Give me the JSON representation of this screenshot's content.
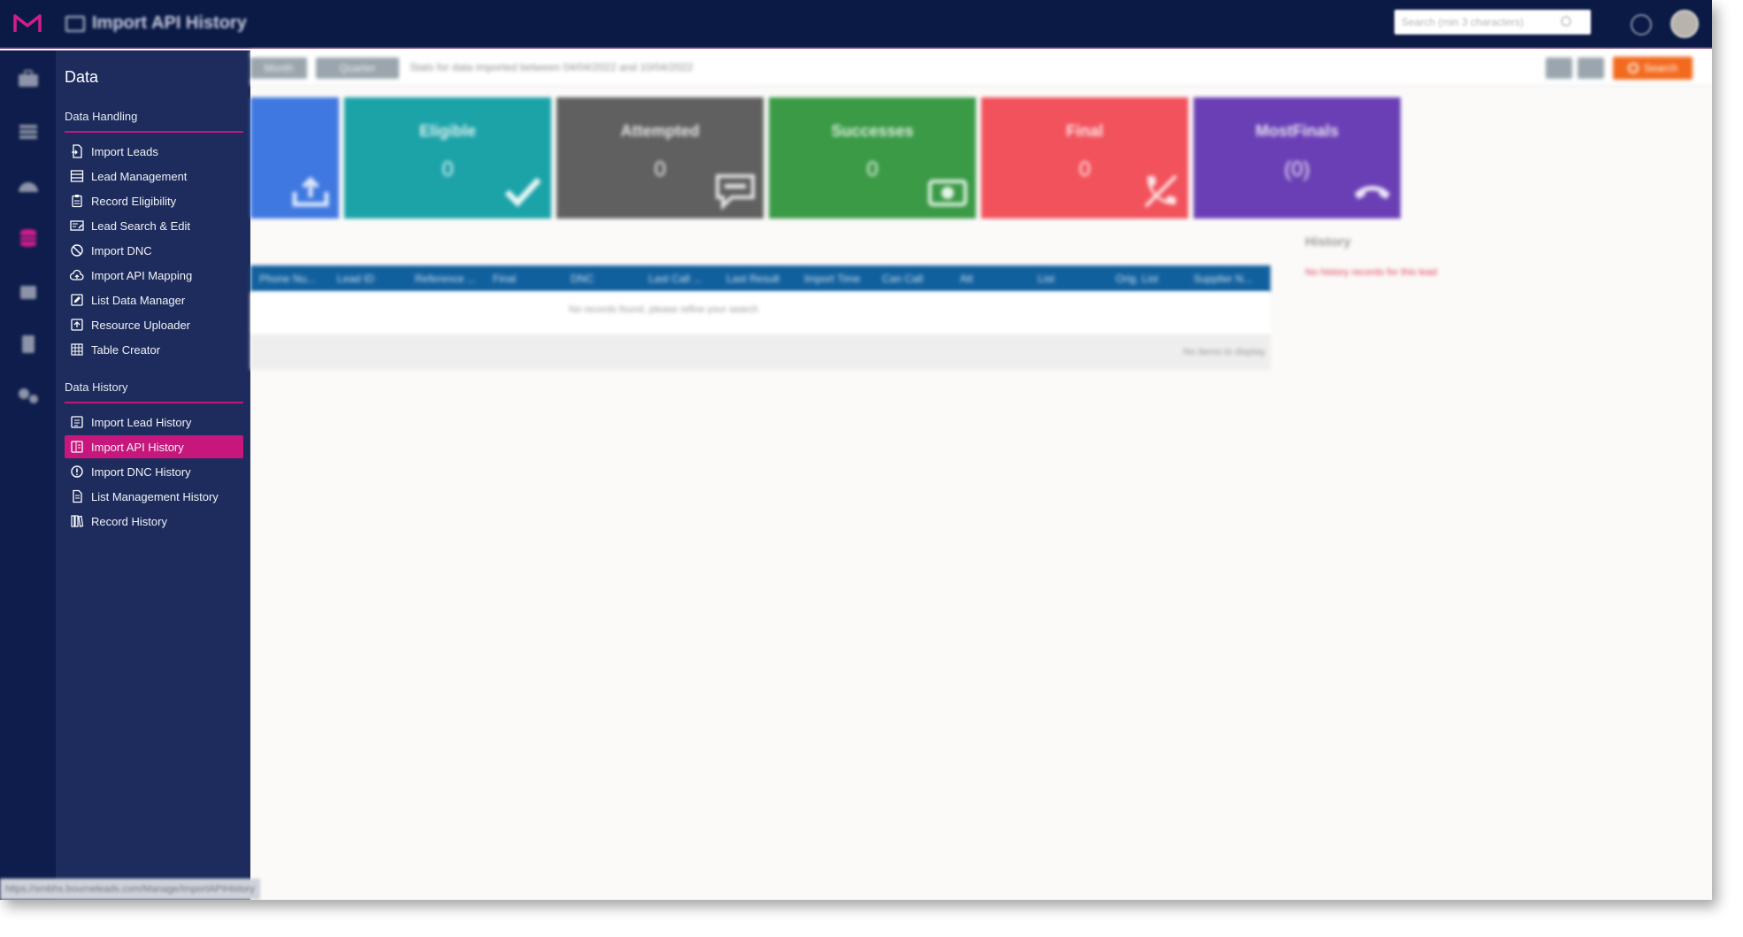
{
  "topbar": {
    "app_title": "Import API History",
    "search_placeholder": "Search (min 3 characters)"
  },
  "sidebar": {
    "title": "Data",
    "sections": [
      {
        "label": "Data Handling",
        "items": [
          {
            "label": "Import Leads",
            "icon": "file-import-icon"
          },
          {
            "label": "Lead Management",
            "icon": "list-icon"
          },
          {
            "label": "Record Eligibility",
            "icon": "clipboard-icon"
          },
          {
            "label": "Lead Search & Edit",
            "icon": "search-edit-icon"
          },
          {
            "label": "Import DNC",
            "icon": "ban-icon"
          },
          {
            "label": "Import API Mapping",
            "icon": "cloud-upload-icon"
          },
          {
            "label": "List Data Manager",
            "icon": "edit-icon"
          },
          {
            "label": "Resource Uploader",
            "icon": "upload-icon"
          },
          {
            "label": "Table Creator",
            "icon": "table-icon"
          }
        ]
      },
      {
        "label": "Data History",
        "items": [
          {
            "label": "Import Lead History",
            "icon": "history-icon"
          },
          {
            "label": "Import API History",
            "icon": "api-history-icon",
            "active": true
          },
          {
            "label": "Import DNC History",
            "icon": "alert-circle-icon"
          },
          {
            "label": "List Management History",
            "icon": "document-icon"
          },
          {
            "label": "Record History",
            "icon": "books-icon"
          }
        ]
      }
    ]
  },
  "toolbar": {
    "month_label": "Month",
    "quarter_label": "Quarter",
    "stats_text": "Stats for data imported between 04/04/2022 and 10/04/2022",
    "search_label": "Search"
  },
  "cards": [
    {
      "label": "",
      "value": "",
      "color": "#3f78e0",
      "icon": "tray-upload-icon"
    },
    {
      "label": "Eligible",
      "value": "0",
      "color": "#1ba3a8",
      "icon": "checkmark-icon"
    },
    {
      "label": "Attempted",
      "value": "0",
      "color": "#606060",
      "icon": "chat-icon"
    },
    {
      "label": "Successes",
      "value": "0",
      "color": "#3a9a46",
      "icon": "money-icon"
    },
    {
      "label": "Final",
      "value": "0",
      "color": "#f2525c",
      "icon": "phone-slash-icon"
    },
    {
      "label": "MostFinals",
      "value": "(0)",
      "color": "#6a3fb5",
      "icon": "phone-hangup-icon"
    }
  ],
  "table": {
    "columns": [
      "Phone Nu...",
      "Lead ID",
      "Reference ...",
      "Final",
      "DNC",
      "Last Call ...",
      "Last Result",
      "Import Time",
      "Can Call",
      "Att",
      "List",
      "Orig. List",
      "Supplier N..."
    ],
    "empty_message": "No records found, please refine your search",
    "footer_text": "No items to display"
  },
  "history": {
    "title": "History",
    "message": "No history records for this lead"
  },
  "statusbar": {
    "url": "https://smbhs.bourneleads.com/Manage/ImportAPIHistory"
  },
  "colors": {
    "accent": "#c7177d",
    "topbar": "#0a1a45",
    "sidebar": "#1d2c5c",
    "table_header": "#11609e",
    "search_button": "#f26a1e"
  }
}
